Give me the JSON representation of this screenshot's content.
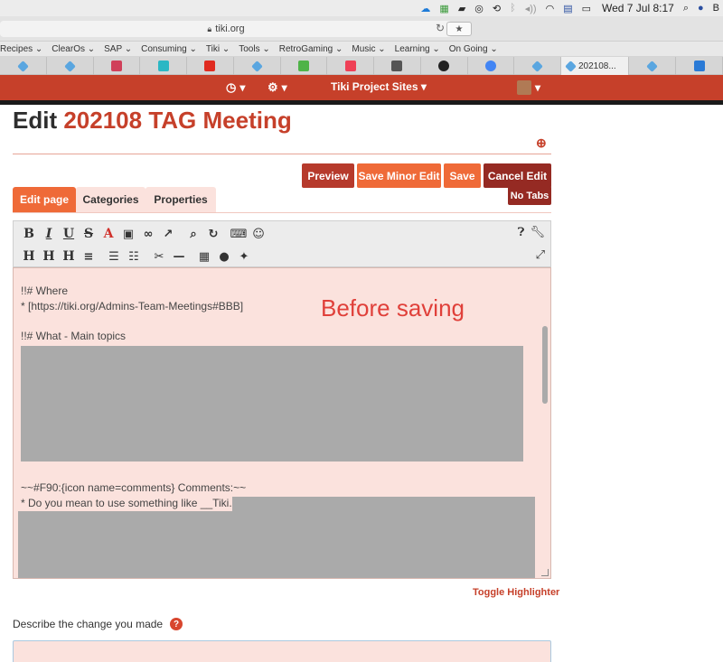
{
  "menubar": {
    "clock": "Wed 7 Jul  8:17",
    "user_initial": "B",
    "colors": {
      "bg": "#ececec"
    }
  },
  "browser": {
    "url": "tiki.org",
    "bookmarks": [
      "Recipes ⌄",
      "ClearOs ⌄",
      "SAP ⌄",
      "Consuming ⌄",
      "Tiki ⌄",
      "Tools ⌄",
      "RetroGaming ⌄",
      "Music ⌄",
      "Learning ⌄",
      "On Going ⌄"
    ],
    "tabs": [
      {
        "icon": "tiki-icon",
        "label": "",
        "color": "#5aa6e0"
      },
      {
        "icon": "tiki-icon",
        "label": "",
        "color": "#5aa6e0"
      },
      {
        "icon": "z-icon",
        "label": "",
        "color": "#d0405a"
      },
      {
        "icon": "s-icon",
        "label": "",
        "color": "#2bb7c4"
      },
      {
        "icon": "youtube-icon",
        "label": "",
        "color": "#e02b20"
      },
      {
        "icon": "tiki-icon",
        "label": "",
        "color": "#5aa6e0"
      },
      {
        "icon": "evernote-icon",
        "label": "",
        "color": "#4fb348"
      },
      {
        "icon": "pocket-icon",
        "label": "",
        "color": "#ef4056"
      },
      {
        "icon": "monitor-icon",
        "label": "",
        "color": "#555555"
      },
      {
        "icon": "github-icon",
        "label": "",
        "color": "#222222"
      },
      {
        "icon": "google-icon",
        "label": "",
        "color": "#4285f4"
      },
      {
        "icon": "tiki-icon",
        "label": "",
        "color": "#5aa6e0"
      },
      {
        "icon": "tiki-icon",
        "label": "202108...",
        "color": "#5aa6e0"
      },
      {
        "icon": "tiki-icon",
        "label": "",
        "color": "#5aa6e0"
      },
      {
        "icon": "flag-icon",
        "label": "",
        "color": "#2a7ad6"
      }
    ]
  },
  "sitenav": {
    "history_caret": "▾",
    "settings_caret": "▾",
    "project_sites": "Tiki Project Sites ▾",
    "user_caret": "▾",
    "colors": {
      "bg": "#c6402a"
    }
  },
  "page": {
    "title_prefix": "Edit",
    "page_name": "202108 TAG Meeting",
    "accent": "#c6402a"
  },
  "actions": {
    "preview": "Preview",
    "save_minor": "Save Minor Edit",
    "save": "Save",
    "cancel": "Cancel Edit",
    "no_tabs": "No Tabs"
  },
  "page_tabs": {
    "edit": "Edit page",
    "categories": "Categories",
    "properties": "Properties"
  },
  "toolbar": {
    "row1": [
      "B",
      "I",
      "U",
      "S",
      "A"
    ],
    "row2": [
      "H",
      "H",
      "H"
    ]
  },
  "editor": {
    "line1": "!!# Where",
    "line2": "* [https://tiki.org/Admins-Team-Meetings#BBB]",
    "line3": "!!# What - Main topics",
    "line4": "~~#F90:{icon name=comments} Comments:~~",
    "line5": "* Do you mean to use something like __Tiki.org__",
    "annotation": "Before saving",
    "annotation_color": "#e0403a"
  },
  "footer": {
    "toggle_highlighter": "Toggle Highlighter",
    "describe_label": "Describe the change you made",
    "help": "?"
  }
}
